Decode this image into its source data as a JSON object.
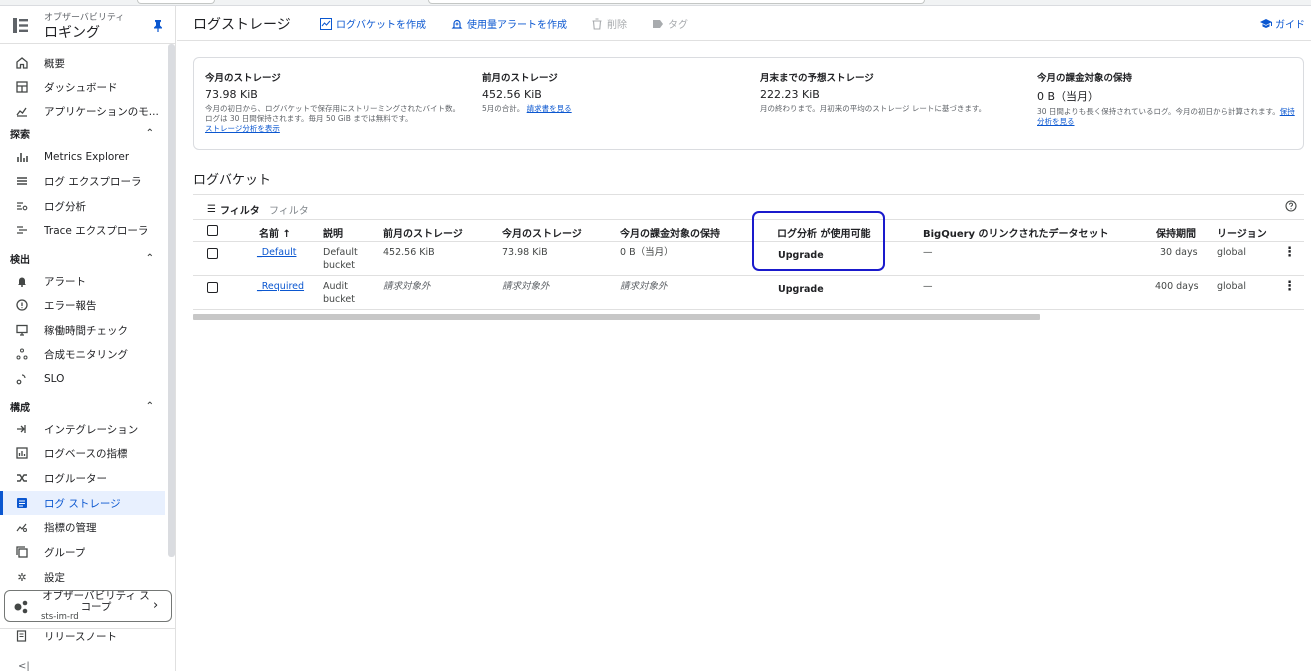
{
  "sidebar": {
    "app_subtitle": "オブザーバビリティ",
    "app_title": "ロギング",
    "items_top": [
      {
        "label": "概要",
        "icon": "home-icon"
      },
      {
        "label": "ダッシュボード",
        "icon": "dashboard-icon"
      },
      {
        "label": "アプリケーションのモ...",
        "icon": "app-monitoring-icon"
      }
    ],
    "sections": {
      "explore": "探索",
      "detect": "検出",
      "configure": "構成"
    },
    "items_explore": [
      {
        "label": "Metrics Explorer",
        "icon": "bar-chart-icon"
      },
      {
        "label": "ログ エクスプローラ",
        "icon": "list-icon"
      },
      {
        "label": "ログ分析",
        "icon": "log-analytics-icon"
      },
      {
        "label": "Trace エクスプローラ",
        "icon": "trace-icon"
      }
    ],
    "items_detect": [
      {
        "label": "アラート",
        "icon": "bell-icon"
      },
      {
        "label": "エラー報告",
        "icon": "error-reporting-icon"
      },
      {
        "label": "稼働時間チェック",
        "icon": "uptime-icon"
      },
      {
        "label": "合成モニタリング",
        "icon": "synthetic-icon"
      },
      {
        "label": "SLO",
        "icon": "slo-icon"
      }
    ],
    "items_configure": [
      {
        "label": "インテグレーション",
        "icon": "integration-icon"
      },
      {
        "label": "ログベースの指標",
        "icon": "log-metrics-icon"
      },
      {
        "label": "ログルーター",
        "icon": "router-icon"
      },
      {
        "label": "ログ ストレージ",
        "icon": "storage-icon"
      },
      {
        "label": "指標の管理",
        "icon": "metrics-management-icon"
      },
      {
        "label": "グループ",
        "icon": "group-icon"
      },
      {
        "label": "設定",
        "icon": "gear-icon"
      }
    ],
    "scope": {
      "title": "オブザーバビリティ スコープ",
      "project": "sts-im-rd"
    },
    "release_notes": "リリースノート",
    "collapse": "<|"
  },
  "toolbar": {
    "page_title": "ログストレージ",
    "create_bucket": "ログバケットを作成",
    "create_alert": "使用量アラートを作成",
    "delete": "削除",
    "tag": "タグ",
    "guide": "ガイド"
  },
  "stats": [
    {
      "heading": "今月のストレージ",
      "value": "73.98 KiB",
      "desc": "今月の初日から、ログバケットで保存用にストリーミングされたバイト数。ログは 30 日間保持されます。毎月 50 GiB までは無料です。",
      "link": "ストレージ分析を表示"
    },
    {
      "heading": "前月のストレージ",
      "value": "452.56 KiB",
      "desc": "5月の合計。",
      "link": "請求書を見る"
    },
    {
      "heading": "月末までの予想ストレージ",
      "value": "222.23 KiB",
      "desc": "月の終わりまで。月初来の平均のストレージ レートに基づきます。",
      "link": ""
    },
    {
      "heading": "今月の課金対象の保持",
      "value": "0 B（当月）",
      "desc": "30 日間よりも長く保持されているログ。今月の初日から計算されます。",
      "link": "保持分析を見る"
    }
  ],
  "buckets_section": {
    "title": "ログバケット",
    "filter_label": "フィルタ",
    "filter_placeholder": "フィルタ"
  },
  "table": {
    "headers": {
      "name": "名前 ↑",
      "description": "説明",
      "prev_storage": "前月のストレージ",
      "cur_storage": "今月のストレージ",
      "billable_retention": "今月の課金対象の保持",
      "log_analytics": "ログ分析 が使用可能",
      "bigquery": "BigQuery のリンクされたデータセット",
      "retention": "保持期間",
      "region": "リージョン"
    },
    "rows": [
      {
        "name": "_Default",
        "desc1": "Default",
        "desc2": "bucket",
        "prev": "452.56 KiB",
        "cur": "73.98 KiB",
        "billable": "0 B（当月）",
        "analytics": "Upgrade",
        "bigquery": "—",
        "retention": "30 days",
        "region": "global"
      },
      {
        "name": "_Required",
        "desc1": "Audit",
        "desc2": "bucket",
        "prev": "請求対象外",
        "cur": "請求対象外",
        "billable": "請求対象外",
        "analytics": "Upgrade",
        "bigquery": "—",
        "retention": "400 days",
        "region": "global"
      }
    ]
  },
  "colors": {
    "accent": "#0b57d0",
    "highlight": "#1a1acc"
  }
}
